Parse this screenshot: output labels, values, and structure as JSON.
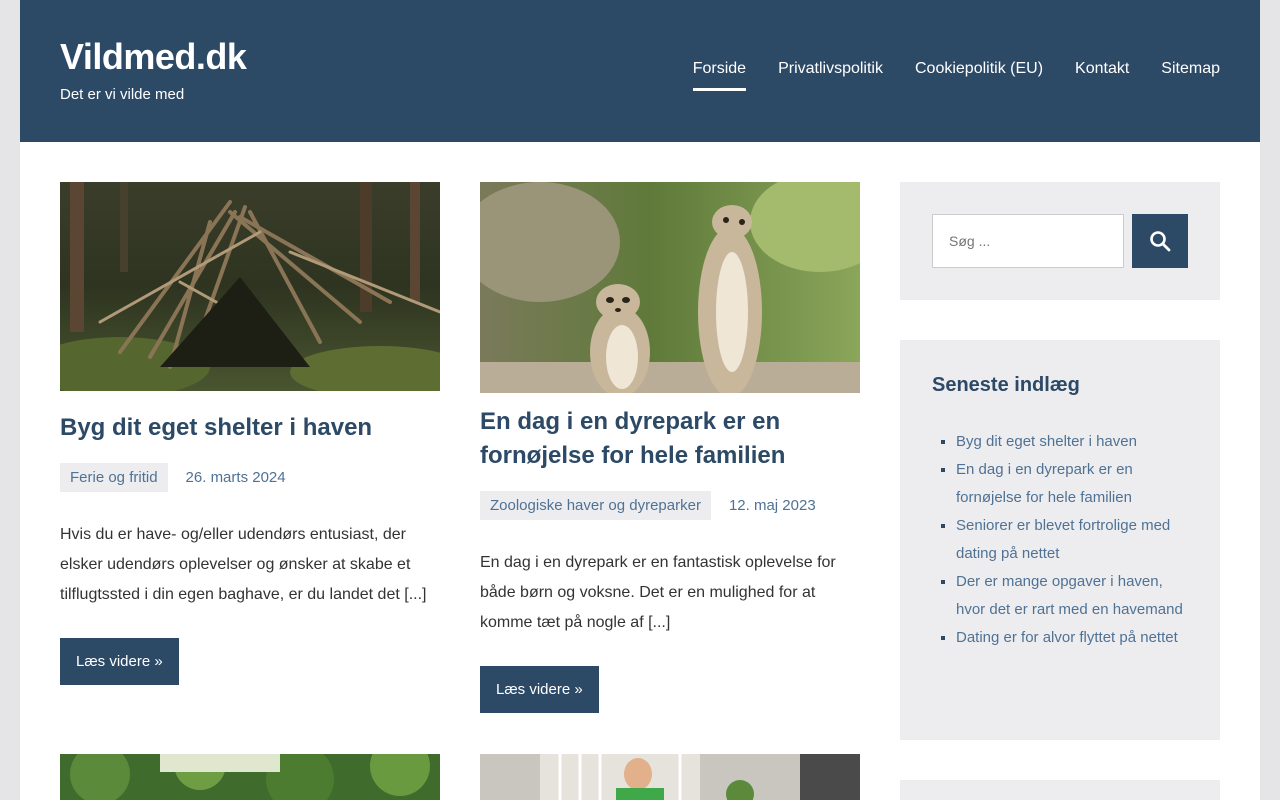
{
  "site": {
    "title": "Vildmed.dk",
    "description": "Det er vi vilde med"
  },
  "nav": [
    {
      "label": "Forside",
      "active": true
    },
    {
      "label": "Privatlivspolitik"
    },
    {
      "label": "Cookiepolitik (EU)"
    },
    {
      "label": "Kontakt"
    },
    {
      "label": "Sitemap"
    }
  ],
  "posts": [
    {
      "title": "Byg dit eget shelter i haven",
      "category": "Ferie og fritid",
      "date": "26. marts 2024",
      "excerpt": "Hvis du er have- og/eller udendørs entusiast, der elsker udendørs oplevelser og ønsker at skabe et tilflugtssted i din egen baghave, er du landet det [...]",
      "more": "Læs videre »",
      "image": "forest-shelter-photo"
    },
    {
      "title": "En dag i en dyrepark er en fornøjelse for hele familien",
      "category": "Zoologiske haver og dyreparker",
      "date": "12. maj 2023",
      "excerpt": "En dag i en dyrepark er en fantastisk oplevelse for både børn og voksne. Det er en mulighed for at komme tæt på nogle af [...]",
      "more": "Læs videre »",
      "image": "meerkats-photo"
    }
  ],
  "search": {
    "placeholder": "Søg ...",
    "icon": "search-icon"
  },
  "recent": {
    "title": "Seneste indlæg",
    "items": [
      "Byg dit eget shelter i haven",
      "En dag i en dyrepark er en fornøjelse for hele familien",
      "Seniorer er blevet fortrolige med dating på nettet",
      "Der er mange opgaver i haven, hvor det er rart med en havemand",
      "Dating er for alvor flyttet på nettet"
    ]
  },
  "colors": {
    "primary": "#2c4966",
    "link": "#4f7294",
    "widget_bg": "#ededf0",
    "page_bg": "#e5e5e8"
  }
}
